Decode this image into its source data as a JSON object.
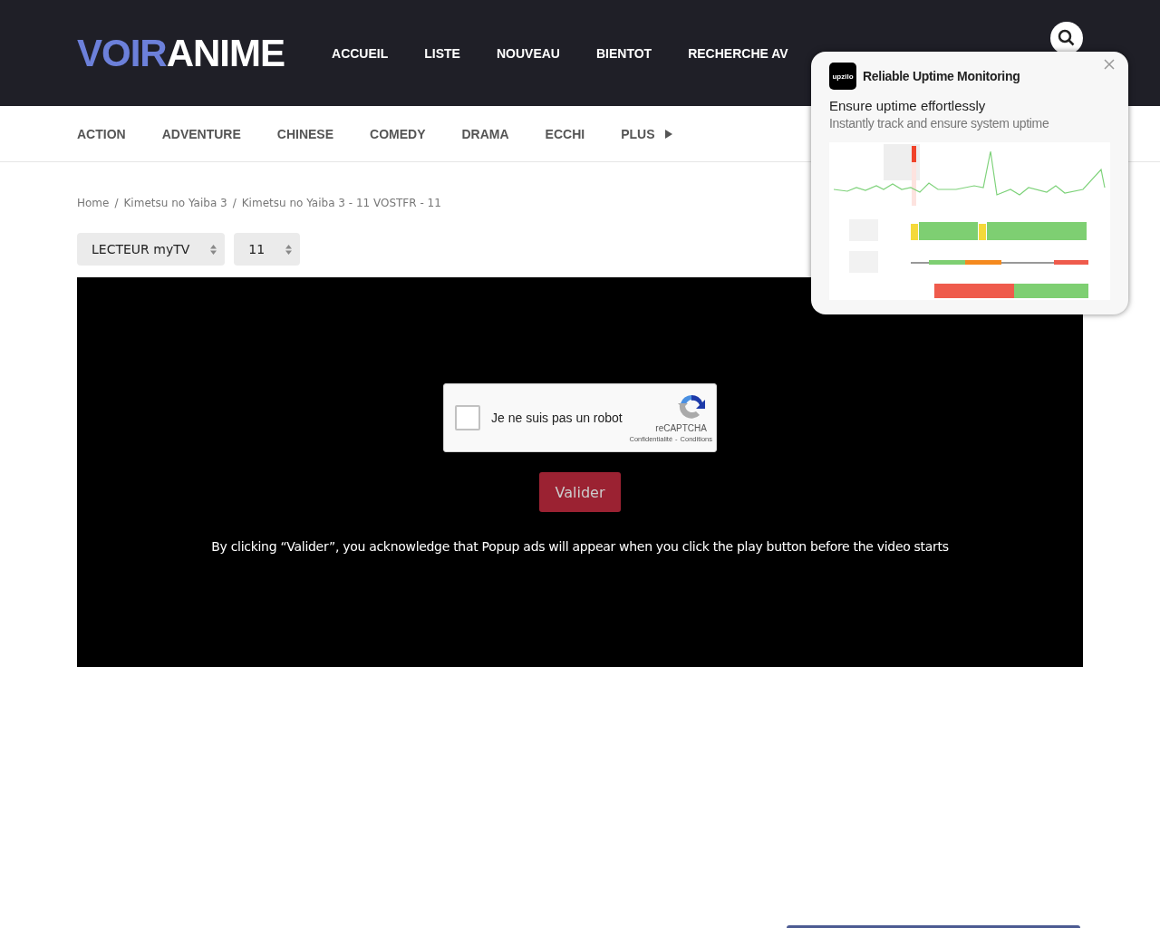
{
  "logo": {
    "first": "VOIR",
    "second": "ANIME"
  },
  "nav": [
    "ACCUEIL",
    "LISTE",
    "NOUVEAU",
    "BIENTOT",
    "RECHERCHE AV"
  ],
  "genres": [
    "ACTION",
    "ADVENTURE",
    "CHINESE",
    "COMEDY",
    "DRAMA",
    "ECCHI"
  ],
  "genres_more": "PLUS",
  "breadcrumb_separator": "/",
  "breadcrumb": [
    "Home",
    "Kimetsu no Yaiba 3",
    "Kimetsu no Yaiba 3 - 11 VOSTFR - 11"
  ],
  "selects": [
    {
      "value": "LECTEUR myTV"
    },
    {
      "value": "11"
    }
  ],
  "captcha": {
    "label": "Je ne suis pas un robot",
    "checked": false,
    "brand": "reCAPTCHA",
    "links": [
      "Confidentialité",
      "Conditions"
    ],
    "link_separator": "-"
  },
  "submit": "Valider",
  "notice": "By clicking “Valider”, you acknowledge that Popup ads will appear when you click the play button before the video starts",
  "ad": {
    "logo": "upzilo",
    "title": "Reliable Uptime Monitoring",
    "headline": "Ensure uptime effortlessly",
    "body": "Instantly track and ensure system uptime"
  }
}
